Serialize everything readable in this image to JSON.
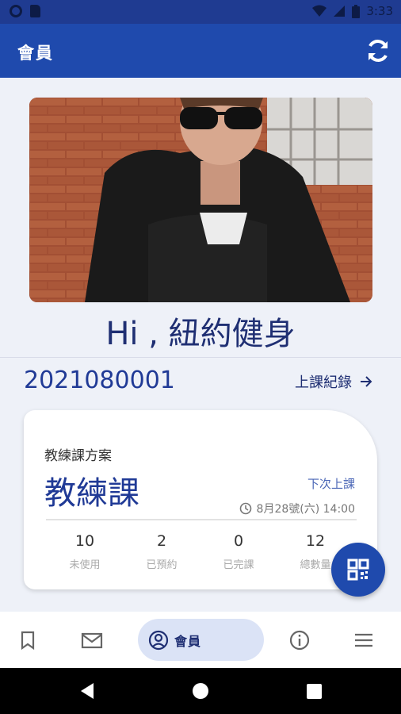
{
  "status_bar": {
    "time": "3:33"
  },
  "app_bar": {
    "title": "會員",
    "refresh_icon": "refresh-icon"
  },
  "profile": {
    "greeting": "Hi , 紐約健身",
    "member_id": "2021080001",
    "class_record_label": "上課紀錄"
  },
  "plan_card": {
    "plan_label": "教練課方案",
    "plan_name": "教練課",
    "next_class_label": "下次上課",
    "next_class_time": "8月28號(六) 14:00",
    "stats": [
      {
        "value": "10",
        "label": "未使用"
      },
      {
        "value": "2",
        "label": "已預約"
      },
      {
        "value": "0",
        "label": "已完課"
      },
      {
        "value": "12",
        "label": "總數量"
      }
    ]
  },
  "bottom_nav": {
    "items": [
      {
        "icon": "bookmark-icon"
      },
      {
        "icon": "mail-icon"
      },
      {
        "icon": "account-circle-icon",
        "label": "會員"
      },
      {
        "icon": "info-icon"
      },
      {
        "icon": "menu-icon"
      }
    ]
  },
  "colors": {
    "primary": "#1f4aad",
    "status_bar": "#1f3b91",
    "text_dark_blue": "#1f2f73",
    "background": "#eef1f8"
  }
}
